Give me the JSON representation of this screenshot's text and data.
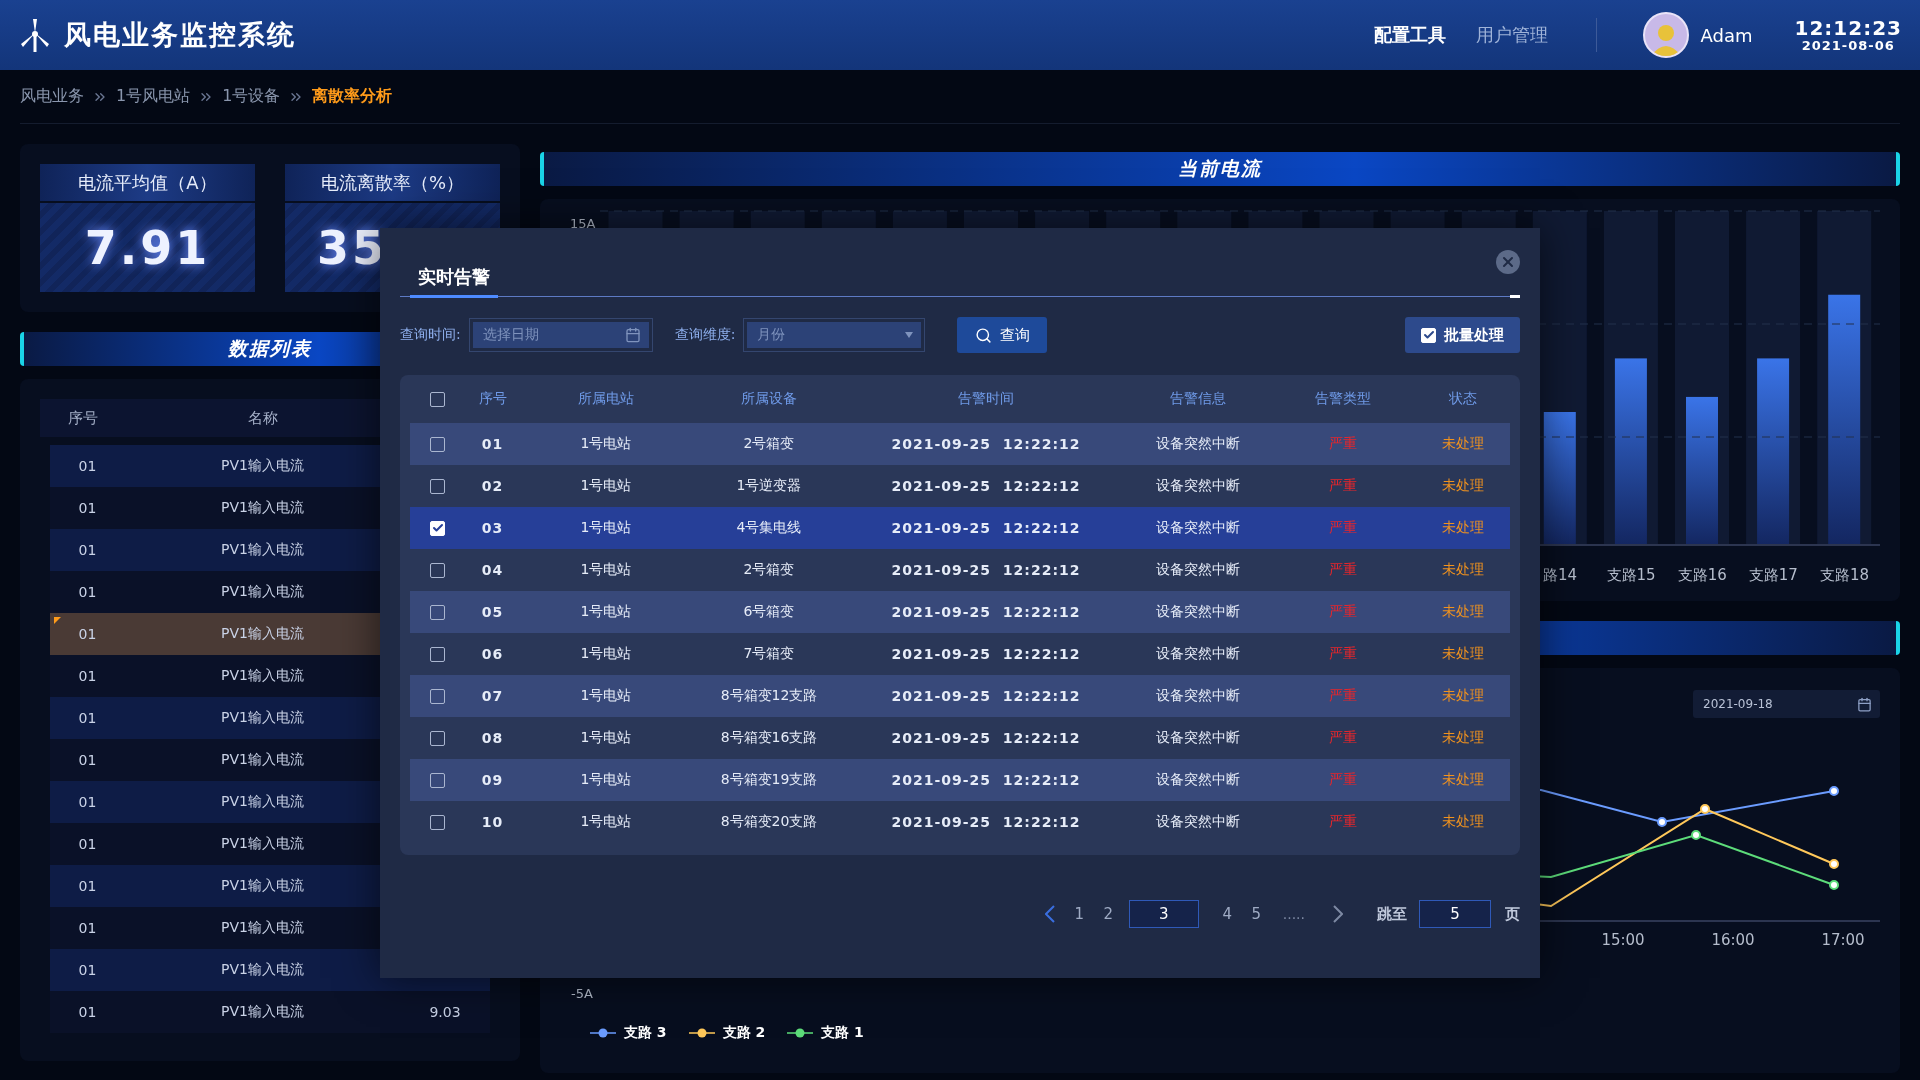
{
  "header": {
    "title": "风电业务监控系统",
    "nav": [
      {
        "label": "配置工具",
        "selected": true
      },
      {
        "label": "用户管理",
        "selected": false
      }
    ],
    "user": {
      "name": "Adam"
    },
    "time": "12:12:23",
    "date": "2021-08-06"
  },
  "breadcrumb": [
    {
      "label": "风电业务",
      "selected": false
    },
    {
      "label": "1号风电站",
      "selected": false
    },
    {
      "label": "1号设备",
      "selected": false
    },
    {
      "label": "离散率分析",
      "selected": true
    }
  ],
  "kpis": [
    {
      "label": "电流平均值（A）",
      "value": "7.91"
    },
    {
      "label": "电流离散率（%）",
      "value": "35"
    }
  ],
  "data_list": {
    "title": "数据列表",
    "columns": [
      "序号",
      "名称"
    ],
    "rows": [
      {
        "no": "01",
        "name": "PV1输入电流",
        "selected": false
      },
      {
        "no": "01",
        "name": "PV1输入电流",
        "selected": false
      },
      {
        "no": "01",
        "name": "PV1输入电流",
        "selected": false
      },
      {
        "no": "01",
        "name": "PV1输入电流",
        "selected": false
      },
      {
        "no": "01",
        "name": "PV1输入电流",
        "selected": true
      },
      {
        "no": "01",
        "name": "PV1输入电流",
        "selected": false
      },
      {
        "no": "01",
        "name": "PV1输入电流",
        "selected": false
      },
      {
        "no": "01",
        "name": "PV1输入电流",
        "selected": false
      },
      {
        "no": "01",
        "name": "PV1输入电流",
        "selected": false
      },
      {
        "no": "01",
        "name": "PV1输入电流",
        "selected": false
      },
      {
        "no": "01",
        "name": "PV1输入电流",
        "selected": false
      },
      {
        "no": "01",
        "name": "PV1输入电流",
        "selected": false
      },
      {
        "no": "01",
        "name": "PV1输入电流",
        "selected": false
      },
      {
        "no": "01",
        "name": "PV1输入电流",
        "value": "9.03",
        "selected": false
      }
    ]
  },
  "current_chart": {
    "title": "当前电流",
    "y_tick": "15A",
    "bar_labels": [
      "路14",
      "支路15",
      "支路16",
      "支路17",
      "支路18"
    ]
  },
  "trend_chart": {
    "date": "2021-09-18",
    "x_labels": [
      "15:00",
      "16:00",
      "17:00"
    ],
    "y_tick": "-5A",
    "legend": [
      {
        "name": "支路 3",
        "color": "#6b9cff"
      },
      {
        "name": "支路 2",
        "color": "#ffc85a"
      },
      {
        "name": "支路 1",
        "color": "#5ddc7a"
      }
    ]
  },
  "alarm_dialog": {
    "tab": "实时告警",
    "time_label": "查询时间:",
    "date_placeholder": "选择日期",
    "dimension_label": "查询维度:",
    "dimension_value": "月份",
    "query_button": "查询",
    "batch": {
      "label": "批量处理",
      "checked": true
    },
    "columns": [
      "序号",
      "所属电站",
      "所属设备",
      "告警时间",
      "告警信息",
      "告警类型",
      "状态"
    ],
    "all_checked": false,
    "rows": [
      {
        "no": "01",
        "station": "1号电站",
        "device": "2号箱变",
        "time": "2021-09-25  12:22:12",
        "info": "设备突然中断",
        "level": "严重",
        "status": "未处理",
        "checked": false
      },
      {
        "no": "02",
        "station": "1号电站",
        "device": "1号逆变器",
        "time": "2021-09-25  12:22:12",
        "info": "设备突然中断",
        "level": "严重",
        "status": "未处理",
        "checked": false
      },
      {
        "no": "03",
        "station": "1号电站",
        "device": "4号集电线",
        "time": "2021-09-25  12:22:12",
        "info": "设备突然中断",
        "level": "严重",
        "status": "未处理",
        "checked": true
      },
      {
        "no": "04",
        "station": "1号电站",
        "device": "2号箱变",
        "time": "2021-09-25  12:22:12",
        "info": "设备突然中断",
        "level": "严重",
        "status": "未处理",
        "checked": false
      },
      {
        "no": "05",
        "station": "1号电站",
        "device": "6号箱变",
        "time": "2021-09-25  12:22:12",
        "info": "设备突然中断",
        "level": "严重",
        "status": "未处理",
        "checked": false
      },
      {
        "no": "06",
        "station": "1号电站",
        "device": "7号箱变",
        "time": "2021-09-25  12:22:12",
        "info": "设备突然中断",
        "level": "严重",
        "status": "未处理",
        "checked": false
      },
      {
        "no": "07",
        "station": "1号电站",
        "device": "8号箱变12支路",
        "time": "2021-09-25  12:22:12",
        "info": "设备突然中断",
        "level": "严重",
        "status": "未处理",
        "checked": false
      },
      {
        "no": "08",
        "station": "1号电站",
        "device": "8号箱变16支路",
        "time": "2021-09-25  12:22:12",
        "info": "设备突然中断",
        "level": "严重",
        "status": "未处理",
        "checked": false
      },
      {
        "no": "09",
        "station": "1号电站",
        "device": "8号箱变19支路",
        "time": "2021-09-25  12:22:12",
        "info": "设备突然中断",
        "level": "严重",
        "status": "未处理",
        "checked": false
      },
      {
        "no": "10",
        "station": "1号电站",
        "device": "8号箱变20支路",
        "time": "2021-09-25  12:22:12",
        "info": "设备突然中断",
        "level": "严重",
        "status": "未处理",
        "checked": false
      }
    ],
    "pages": [
      {
        "label": "1",
        "selected": false
      },
      {
        "label": "2",
        "selected": false
      },
      {
        "label": "3",
        "selected": true
      },
      {
        "label": "4",
        "selected": false
      },
      {
        "label": "5",
        "selected": false
      }
    ],
    "ellipsis": ".....",
    "jump_label": "跳至",
    "jump_value": "5",
    "jump_unit": "页"
  }
}
